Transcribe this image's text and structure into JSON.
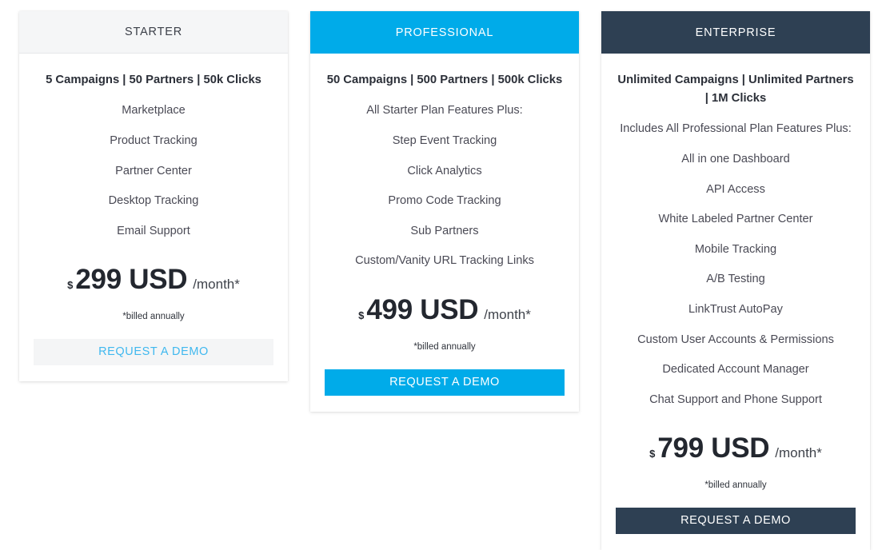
{
  "plans": [
    {
      "id": "starter",
      "name": "STARTER",
      "headline": "5 Campaigns | 50 Partners | 50k Clicks",
      "features": [
        "Marketplace",
        "Product Tracking",
        "Partner Center",
        "Desktop Tracking",
        "Email Support"
      ],
      "price": {
        "currency": "$",
        "amount": "299 USD",
        "period": "/month*"
      },
      "billed_note": "*billed annually",
      "cta_label": "REQUEST A DEMO",
      "header_bg": "#f5f6f7",
      "header_text": "#3c4049",
      "button_bg": "#f4f5f6",
      "button_text": "#3fb8ef"
    },
    {
      "id": "professional",
      "name": "PROFESSIONAL",
      "headline": "50 Campaigns | 500 Partners | 500k Clicks",
      "features": [
        "All Starter Plan Features Plus:",
        "Step Event Tracking",
        "Click Analytics",
        "Promo Code Tracking",
        "Sub Partners",
        "Custom/Vanity URL Tracking Links"
      ],
      "price": {
        "currency": "$",
        "amount": "499 USD",
        "period": "/month*"
      },
      "billed_note": "*billed annually",
      "cta_label": "REQUEST A DEMO",
      "header_bg": "#00abe9",
      "header_text": "#ffffff",
      "button_bg": "#00abe9",
      "button_text": "#ffffff"
    },
    {
      "id": "enterprise",
      "name": "ENTERPRISE",
      "headline": "Unlimited Campaigns | Unlimited Partners | 1M Clicks",
      "features": [
        "Includes All Professional Plan Features Plus:",
        "All in one Dashboard",
        "API Access",
        "White Labeled Partner Center",
        "Mobile Tracking",
        "A/B Testing",
        "LinkTrust AutoPay",
        "Custom User Accounts & Permissions",
        "Dedicated Account Manager",
        "Chat Support and Phone Support"
      ],
      "price": {
        "currency": "$",
        "amount": "799 USD",
        "period": "/month*"
      },
      "billed_note": "*billed annually",
      "cta_label": "REQUEST A DEMO",
      "header_bg": "#2e4053",
      "header_text": "#ffffff",
      "button_bg": "#2e4053",
      "button_text": "#ffffff"
    }
  ]
}
